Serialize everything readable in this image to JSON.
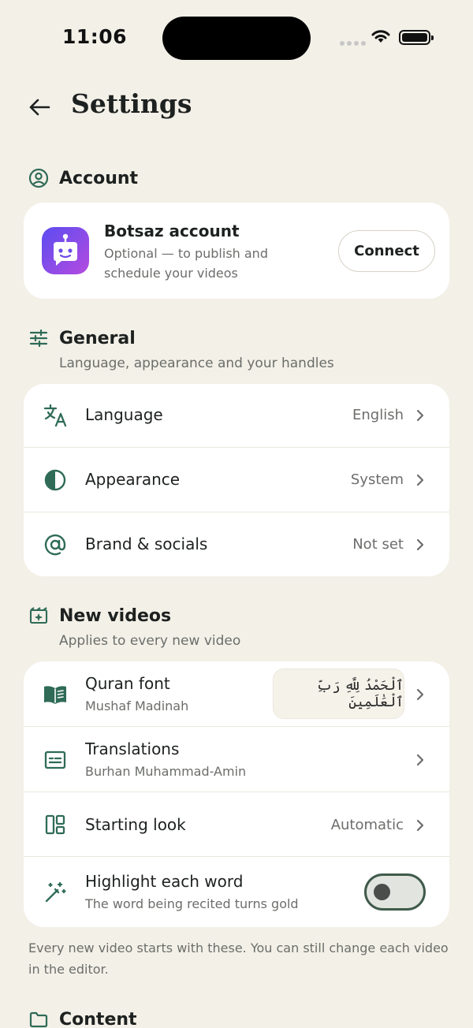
{
  "status_bar": {
    "time": "11:06"
  },
  "header": {
    "title": "Settings"
  },
  "account": {
    "section_title": "Account",
    "card_title": "Botsaz account",
    "card_subtitle": "Optional — to publish and schedule your videos",
    "connect_label": "Connect"
  },
  "general": {
    "section_title": "General",
    "section_subtitle": "Language, appearance and your handles",
    "rows": [
      {
        "label": "Language",
        "value": "English",
        "icon": "translate-icon"
      },
      {
        "label": "Appearance",
        "value": "System",
        "icon": "contrast-icon"
      },
      {
        "label": "Brand & socials",
        "value": "Not set",
        "icon": "at-sign-icon"
      }
    ]
  },
  "new_videos": {
    "section_title": "New videos",
    "section_subtitle": "Applies to every new video",
    "quran_font": {
      "label": "Quran font",
      "sub": "Mushaf Madinah",
      "preview": "ٱلْحَمْدُ لِلَّهِ رَبِّ ٱلْعَٰلَمِينَ"
    },
    "translations": {
      "label": "Translations",
      "sub": "Burhan Muhammad-Amin"
    },
    "starting_look": {
      "label": "Starting look",
      "value": "Automatic"
    },
    "highlight": {
      "label": "Highlight each word",
      "sub": "The word being recited turns gold",
      "enabled": false
    },
    "footnote": "Every new video starts with these. You can still change each video in the editor."
  },
  "content": {
    "section_title": "Content"
  },
  "colors": {
    "accent": "#2f6b57",
    "background": "#f3f0e8",
    "card": "#ffffff"
  }
}
